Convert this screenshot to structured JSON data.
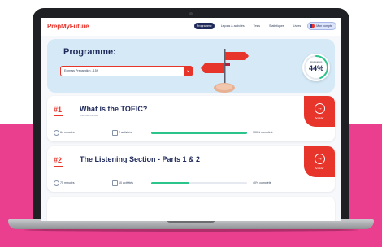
{
  "nav": {
    "logo": "PrepMyFuture",
    "items": [
      "Programme",
      "Leçons & activités",
      "Tests",
      "Statistiques",
      "Livres"
    ],
    "active_index": 0,
    "account_label": "Mon compte"
  },
  "hero": {
    "title": "Programme:",
    "select_value": "Express Preparation - 15h",
    "select_button_icon": "chevron-down-icon",
    "progress_label": "progression",
    "progress_value": "44%",
    "progress_fraction": 0.44
  },
  "cards": [
    {
      "number": "#1",
      "title": "What is the TOEIC?",
      "subtitle": "Discover the test",
      "action_label": "Accéder",
      "duration": "64 minutes",
      "activities": "2 activités",
      "progress_fraction": 1.0,
      "progress_text": "100% complété"
    },
    {
      "number": "#2",
      "title": "The Listening Section - Parts 1 & 2",
      "subtitle": "",
      "action_label": "Accéder",
      "duration": "75 minutes",
      "activities": "10 activités",
      "progress_fraction": 0.4,
      "progress_text": "40% complété"
    }
  ],
  "colors": {
    "brand_red": "#e8352c",
    "navy": "#1f2a5a",
    "hero_bg": "#d5e9f7",
    "progress_green": "#2bc48a",
    "background_pink": "#ea3f8f"
  }
}
